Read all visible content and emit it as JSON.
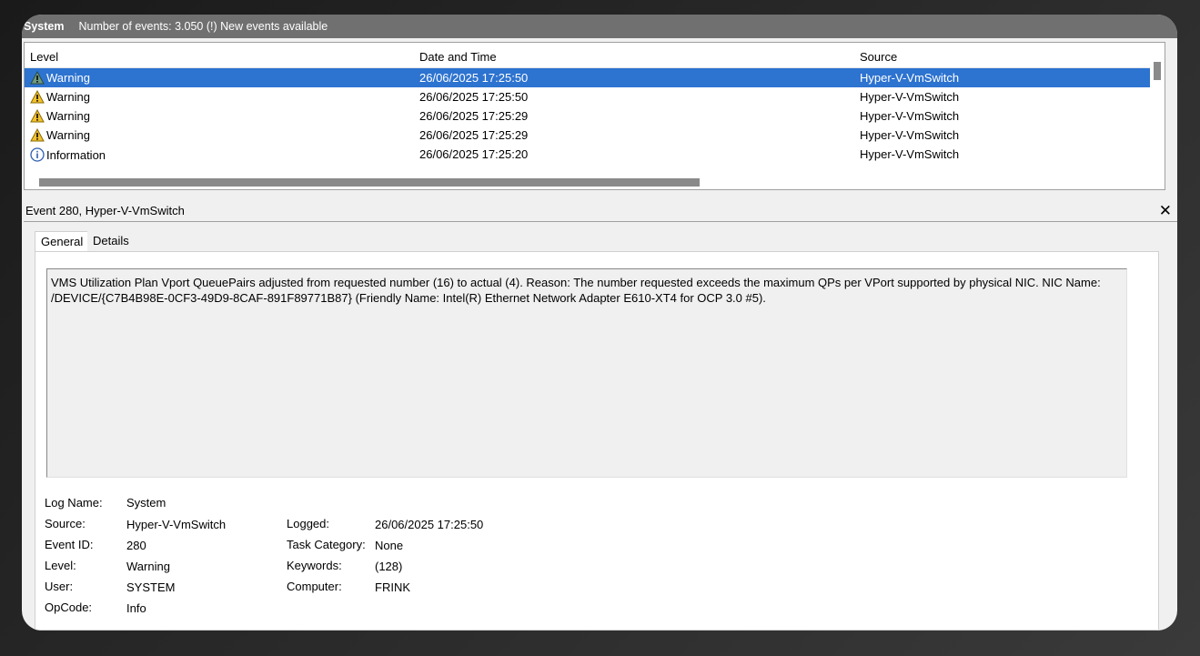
{
  "titlebar": {
    "log_name": "System",
    "summary": "Number of events: 3.050 (!) New events available"
  },
  "grid": {
    "columns": [
      "Level",
      "Date and Time",
      "Source"
    ],
    "rows": [
      {
        "level": "Warning",
        "icon": "warning-icon",
        "date": "26/06/2025 17:25:50",
        "source": "Hyper-V-VmSwitch",
        "selected": true
      },
      {
        "level": "Warning",
        "icon": "warning-icon",
        "date": "26/06/2025 17:25:50",
        "source": "Hyper-V-VmSwitch",
        "selected": false
      },
      {
        "level": "Warning",
        "icon": "warning-icon",
        "date": "26/06/2025 17:25:29",
        "source": "Hyper-V-VmSwitch",
        "selected": false
      },
      {
        "level": "Warning",
        "icon": "warning-icon",
        "date": "26/06/2025 17:25:29",
        "source": "Hyper-V-VmSwitch",
        "selected": false
      },
      {
        "level": "Information",
        "icon": "info-icon",
        "date": "26/06/2025 17:25:20",
        "source": "Hyper-V-VmSwitch",
        "selected": false
      }
    ]
  },
  "detail": {
    "title": "Event 280, Hyper-V-VmSwitch",
    "close_icon": "close-icon",
    "close_glyph": "✕",
    "tabs": [
      "General",
      "Details"
    ],
    "description": "VMS Utilization Plan Vport QueuePairs adjusted from requested number (16) to actual (4). Reason: The number requested exceeds the maximum QPs per VPort supported by physical NIC. NIC Name: /DEVICE/{C7B4B98E-0CF3-49D9-8CAF-891F89771B87} (Friendly Name: Intel(R) Ethernet Network Adapter E610-XT4 for OCP 3.0 #5).",
    "props": {
      "log_name_label": "Log Name:",
      "log_name": "System",
      "source_label": "Source:",
      "source": "Hyper-V-VmSwitch",
      "logged_label": "Logged:",
      "logged": "26/06/2025 17:25:50",
      "event_id_label": "Event ID:",
      "event_id": "280",
      "task_category_label": "Task Category:",
      "task_category": "None",
      "level_label": "Level:",
      "level": "Warning",
      "keywords_label": "Keywords:",
      "keywords": "(128)",
      "user_label": "User:",
      "user": "SYSTEM",
      "computer_label": "Computer:",
      "computer": "FRINK",
      "opcode_label": "OpCode:",
      "opcode": "Info"
    }
  },
  "colors": {
    "selection": "#2d73d0",
    "titlebar": "#707070",
    "warning": "#f2c12e"
  }
}
